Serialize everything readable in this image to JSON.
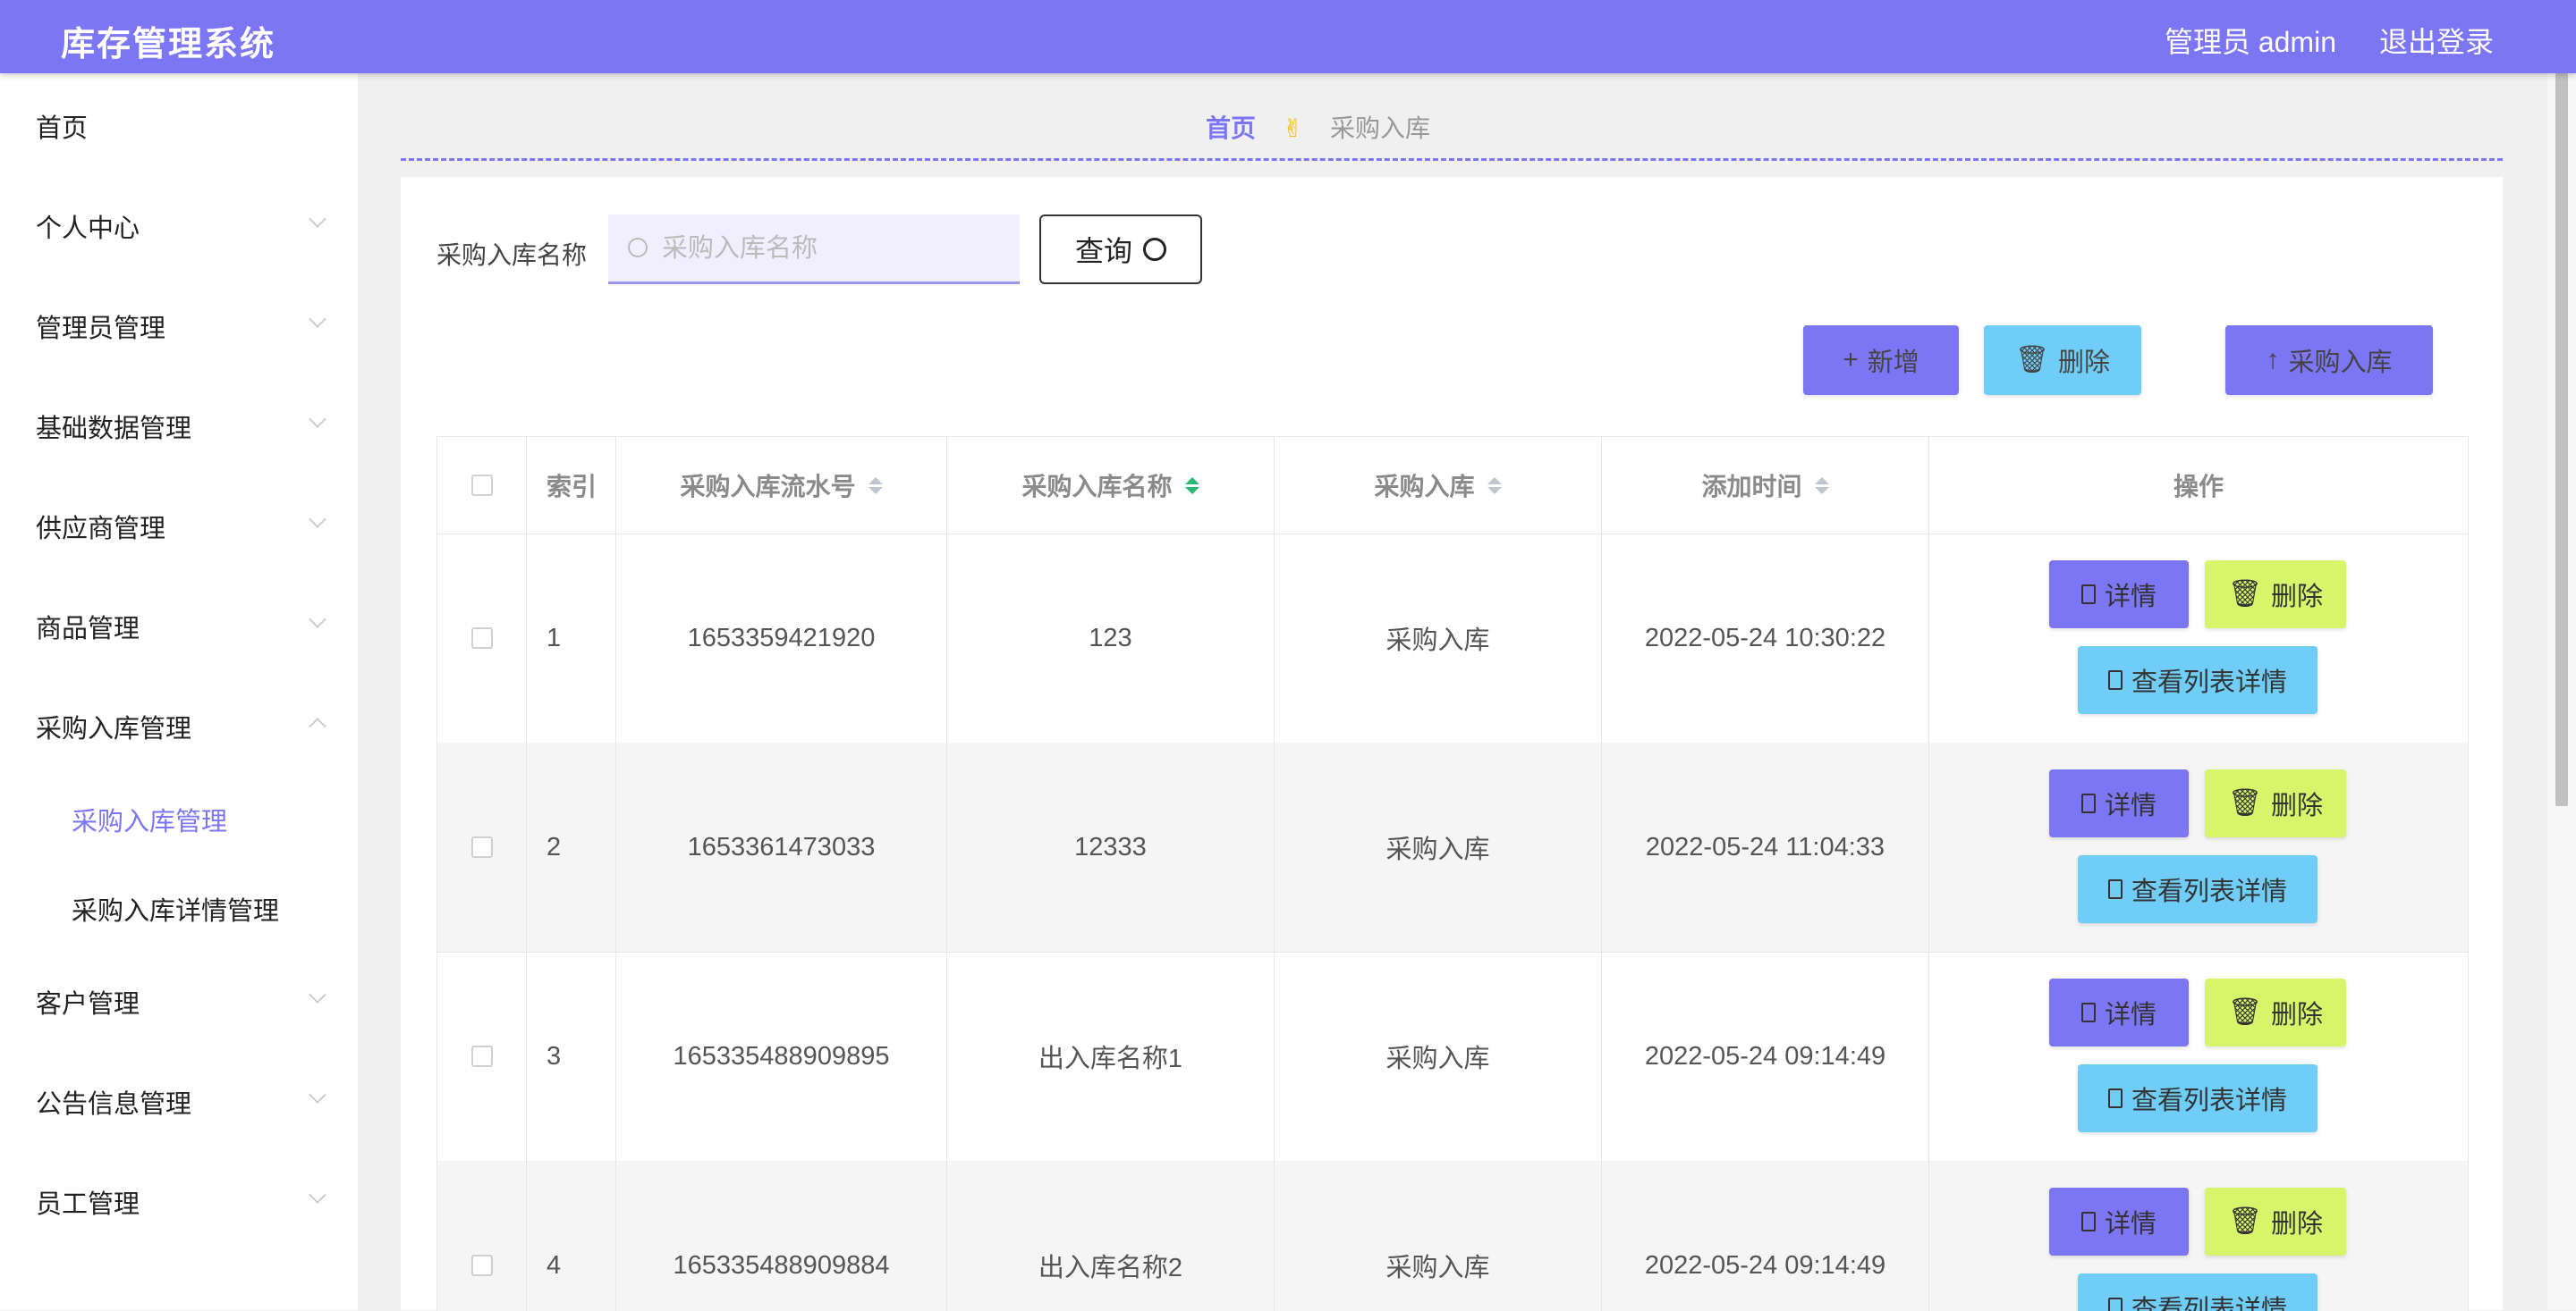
{
  "app": {
    "title": "库存管理系统",
    "admin_label": "管理员 admin",
    "logout_label": "退出登录"
  },
  "sidebar": {
    "items": [
      {
        "label": "首页"
      },
      {
        "label": "个人中心"
      },
      {
        "label": "管理员管理"
      },
      {
        "label": "基础数据管理"
      },
      {
        "label": "供应商管理"
      },
      {
        "label": "商品管理"
      },
      {
        "label": "采购入库管理"
      },
      {
        "label": "客户管理"
      },
      {
        "label": "公告信息管理"
      },
      {
        "label": "员工管理"
      }
    ],
    "submenu": [
      {
        "label": "采购入库管理",
        "active": true
      },
      {
        "label": "采购入库详情管理",
        "active": false
      }
    ]
  },
  "breadcrumb": {
    "home": "首页",
    "separator": "✌",
    "current": "采购入库"
  },
  "search": {
    "label": "采购入库名称",
    "placeholder": "采购入库名称",
    "value": "",
    "button_label": "查询"
  },
  "actions": {
    "add_label": "新增",
    "delete_label": "删除",
    "purchase_in_label": "采购入库"
  },
  "table": {
    "columns": [
      "索引",
      "采购入库流水号",
      "采购入库名称",
      "采购入库",
      "添加时间",
      "操作"
    ],
    "sorted_column": "采购入库名称",
    "rows": [
      {
        "index": "1",
        "serial": "1653359421920",
        "name": "123",
        "type": "采购入库",
        "time": "2022-05-24 10:30:22"
      },
      {
        "index": "2",
        "serial": "1653361473033",
        "name": "12333",
        "type": "采购入库",
        "time": "2022-05-24 11:04:33"
      },
      {
        "index": "3",
        "serial": "165335488909895",
        "name": "出入库名称1",
        "type": "采购入库",
        "time": "2022-05-24 09:14:49"
      },
      {
        "index": "4",
        "serial": "165335488909884",
        "name": "出入库名称2",
        "type": "采购入库",
        "time": "2022-05-24 09:14:49"
      }
    ],
    "row_actions": {
      "detail_label": "详情",
      "delete_label": "删除",
      "list_detail_label": "查看列表详情"
    }
  },
  "colors": {
    "primary": "#7c76f5",
    "info": "#6fcdf7",
    "warning": "#d6f56a",
    "sort_active": "#2bb673"
  }
}
